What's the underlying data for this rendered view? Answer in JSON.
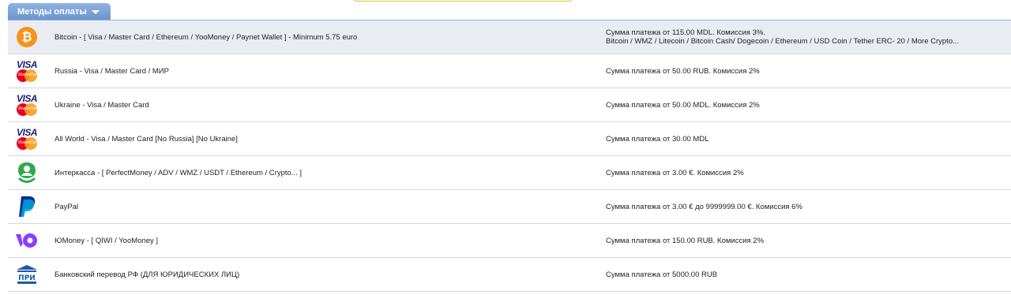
{
  "tab": {
    "label": "Методы оплаты",
    "accent": "#7ea4d8"
  },
  "payment_methods": [
    {
      "icon": "bitcoin-icon",
      "name": "Bitcoin - [ Visa / Master Card / Ethereum / YooMoney / Paynet Wallet ] - Minimum 5.75 euro",
      "info_line1": "Сумма платежа от 115.00 MDL. Комиссия 3%.",
      "info_line2": "Bitcoin / WMZ / Litecoin / Bitcoin Cash/ Dogecoin / Ethereum / USD Coin / Tether ERC- 20 / More Crypto..."
    },
    {
      "icon": "visa-mastercard-icon",
      "name": "Russia - Visa / Master Card / МИР",
      "info_line1": "Сумма платежа от 50.00 RUB. Комиссия 2%"
    },
    {
      "icon": "visa-mastercard-icon",
      "name": "Ukraine - Visa / Master Card",
      "info_line1": "Сумма платежа от 50.00 MDL. Комиссия 2%"
    },
    {
      "icon": "visa-mastercard-icon",
      "name": "All World - Visa / Master Card [No Russia] [No Ukraine]",
      "info_line1": "Сумма платежа от 30.00 MDL"
    },
    {
      "icon": "interkassa-icon",
      "name": "Интеркасса - [ PerfectMoney / ADV / WMZ / USDT / Ethereum / Crypto... ]",
      "info_line1": "Сумма платежа от 3.00 €. Комиссия 2%"
    },
    {
      "icon": "paypal-icon",
      "name": "PayPal",
      "info_line1": "Сумма платежа от 3.00 € до 9999999.00 €. Комиссия 6%"
    },
    {
      "icon": "yoomoney-icon",
      "name": "ЮMoney - [ QIWI / YooMoney ]",
      "info_line1": "Сумма платежа от 150.00 RUB. Комиссия 2%"
    },
    {
      "icon": "bank-transfer-icon",
      "name": "Банковский перевод РФ (ДЛЯ ЮРИДИЧЕСКИХ ЛИЦ)",
      "info_line1": "Сумма платежа от 5000.00 RUB"
    }
  ],
  "icon_text": {
    "bitcoin": "₿",
    "visa": "VISA",
    "mastercard": "MasterCard",
    "bank": "ПРИ"
  },
  "colors": {
    "bitcoin": "#f7931a",
    "visa": "#1a1f71",
    "interkassa": "#2fa84f",
    "paypal": "#003087",
    "yoomoney": "#8b3ffd",
    "bank": "#1e5aa8",
    "selected_row": "#e9edf2"
  }
}
